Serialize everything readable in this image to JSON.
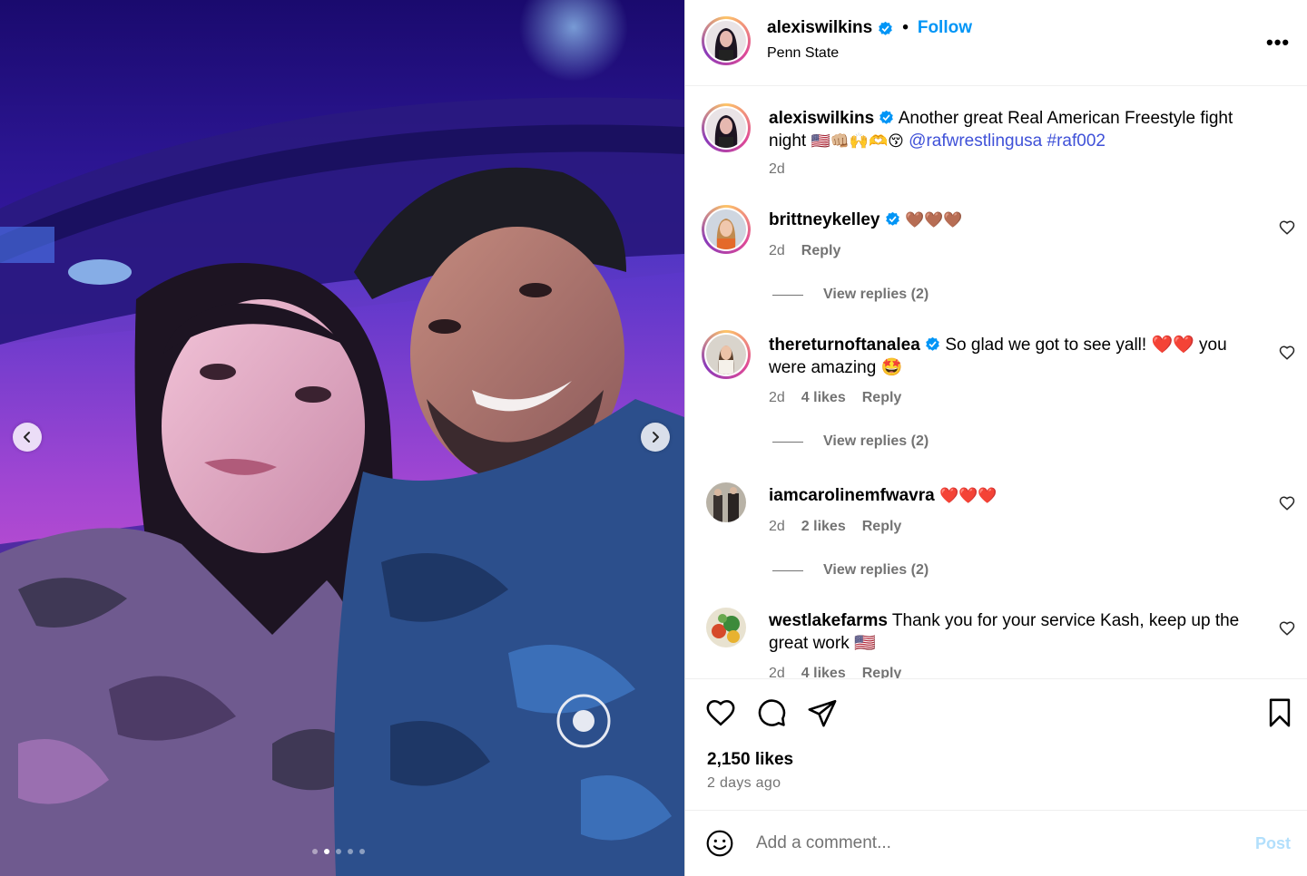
{
  "post": {
    "author": "alexiswilkins",
    "follow_label": "Follow",
    "separator": "•",
    "location": "Penn State",
    "more_label": "•••"
  },
  "caption": {
    "username": "alexiswilkins",
    "text": "Another great Real American Freestyle fight night",
    "emojis": "🇺🇸👊🏼🙌🫶😚",
    "mention": "@rafwrestlingusa",
    "hashtag": "#raf002",
    "time": "2d"
  },
  "comments": [
    {
      "username": "brittneykelley",
      "text": "🤎🤎🤎",
      "time": "2d",
      "likes": "",
      "reply": "Reply",
      "view_replies": "View replies (2)"
    },
    {
      "username": "thereturnoftanalea",
      "text": "So glad we got to see yall! ❤️❤️ you were amazing 🤩",
      "time": "2d",
      "likes": "4 likes",
      "reply": "Reply",
      "view_replies": "View replies (2)"
    },
    {
      "username": "iamcarolinemfwavra",
      "text": "❤️❤️❤️",
      "time": "2d",
      "likes": "2 likes",
      "reply": "Reply",
      "view_replies": "View replies (2)"
    },
    {
      "username": "westlakefarms",
      "text": "Thank you for your service Kash, keep up the great work 🇺🇸",
      "time": "2d",
      "likes": "4 likes",
      "reply": "Reply"
    }
  ],
  "stats": {
    "likes": "2,150 likes",
    "ago": "2 days ago"
  },
  "composer": {
    "placeholder": "Add a comment...",
    "post_label": "Post"
  },
  "carousel": {
    "total": 5,
    "active_index": 1
  },
  "colors": {
    "accent": "#0095f6",
    "link": "#3f51d8",
    "verified": "#0095f6",
    "muted": "#737373"
  },
  "icons": [
    "chevron-left-icon",
    "chevron-right-icon",
    "verified-icon",
    "more-icon",
    "heart-icon",
    "comment-icon",
    "share-icon",
    "bookmark-icon",
    "emoji-icon"
  ]
}
